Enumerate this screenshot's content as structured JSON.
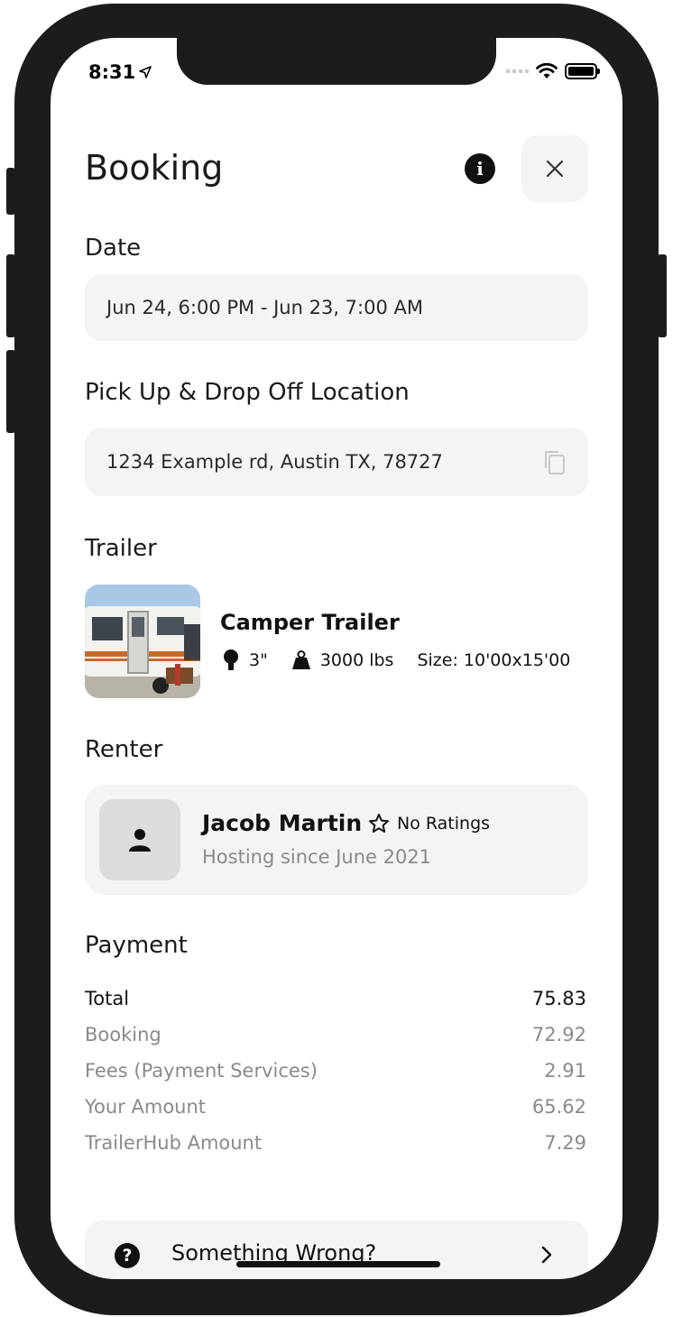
{
  "status_bar": {
    "time": "8:31"
  },
  "header": {
    "title": "Booking"
  },
  "date": {
    "label": "Date",
    "value": "Jun 24, 6:00 PM - Jun 23, 7:00 AM"
  },
  "location": {
    "label": "Pick Up & Drop Off Location",
    "value": "1234 Example rd, Austin TX, 78727"
  },
  "trailer": {
    "label": "Trailer",
    "name": "Camper Trailer",
    "hitch": "3\"",
    "weight": "3000 lbs",
    "size": "Size: 10'00x15'00"
  },
  "renter": {
    "label": "Renter",
    "name": "Jacob Martin",
    "rating": "No Ratings",
    "since": "Hosting since June 2021"
  },
  "payment": {
    "label": "Payment",
    "rows": [
      {
        "label": "Total",
        "value": "75.83"
      },
      {
        "label": "Booking",
        "value": "72.92"
      },
      {
        "label": "Fees (Payment Services)",
        "value": "2.91"
      },
      {
        "label": "Your Amount",
        "value": "65.62"
      },
      {
        "label": "TrailerHub Amount",
        "value": "7.29"
      }
    ]
  },
  "help": {
    "label": "Something Wrong?"
  },
  "icons": {
    "info": "info-icon",
    "close": "close-icon",
    "copy": "copy-icon",
    "hitch": "trailer-hitch-icon",
    "weight": "weight-icon",
    "star": "star-outline-icon",
    "avatar": "person-icon",
    "help": "question-icon",
    "chevron": "chevron-right-icon",
    "location_arrow": "location-arrow-icon",
    "wifi": "wifi-icon",
    "battery": "battery-icon"
  },
  "colors": {
    "field_bg": "#f4f4f4",
    "muted_text": "#8a8a8a",
    "frame": "#1c1c1e"
  }
}
